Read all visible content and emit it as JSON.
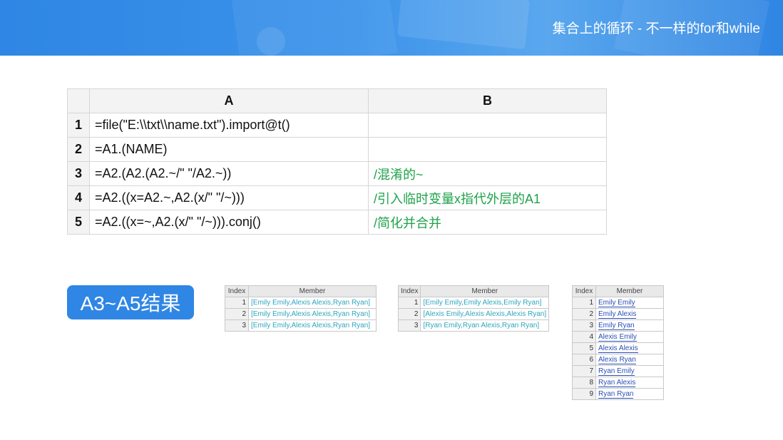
{
  "header": {
    "title": "集合上的循环 - 不一样的for和while"
  },
  "grid": {
    "columns": [
      "A",
      "B"
    ],
    "rows": [
      {
        "num": "1",
        "a": "=file(\"E:\\\\txt\\\\name.txt\").import@t()",
        "b": ""
      },
      {
        "num": "2",
        "a": "=A1.(NAME)",
        "b": ""
      },
      {
        "num": "3",
        "a": "=A2.(A2.(A2.~/\" \"/A2.~))",
        "b": "/混淆的~"
      },
      {
        "num": "4",
        "a": "=A2.((x=A2.~,A2.(x/\" \"/~)))",
        "b": "/引入临时变量x指代外层的A1"
      },
      {
        "num": "5",
        "a": "=A2.((x=~,A2.(x/\" \"/~))).conj()",
        "b": "/简化并合并"
      }
    ]
  },
  "result_badge": "A3~A5结果",
  "results": [
    {
      "headers": [
        "Index",
        "Member"
      ],
      "rows": [
        {
          "index": "1",
          "member": "[Emily Emily,Alexis Alexis,Ryan Ryan]"
        },
        {
          "index": "2",
          "member": "[Emily Emily,Alexis Alexis,Ryan Ryan]"
        },
        {
          "index": "3",
          "member": "[Emily Emily,Alexis Alexis,Ryan Ryan]"
        }
      ]
    },
    {
      "headers": [
        "Index",
        "Member"
      ],
      "rows": [
        {
          "index": "1",
          "member": "[Emily Emily,Emily Alexis,Emily Ryan]"
        },
        {
          "index": "2",
          "member": "[Alexis Emily,Alexis Alexis,Alexis Ryan]"
        },
        {
          "index": "3",
          "member": "[Ryan Emily,Ryan Alexis,Ryan Ryan]"
        }
      ]
    },
    {
      "headers": [
        "Index",
        "Member"
      ],
      "rows": [
        {
          "index": "1",
          "member": "Emily Emily"
        },
        {
          "index": "2",
          "member": "Emily Alexis"
        },
        {
          "index": "3",
          "member": "Emily Ryan"
        },
        {
          "index": "4",
          "member": "Alexis Emily"
        },
        {
          "index": "5",
          "member": "Alexis Alexis"
        },
        {
          "index": "6",
          "member": "Alexis Ryan"
        },
        {
          "index": "7",
          "member": "Ryan Emily"
        },
        {
          "index": "8",
          "member": "Ryan Alexis"
        },
        {
          "index": "9",
          "member": "Ryan Ryan"
        }
      ]
    }
  ]
}
